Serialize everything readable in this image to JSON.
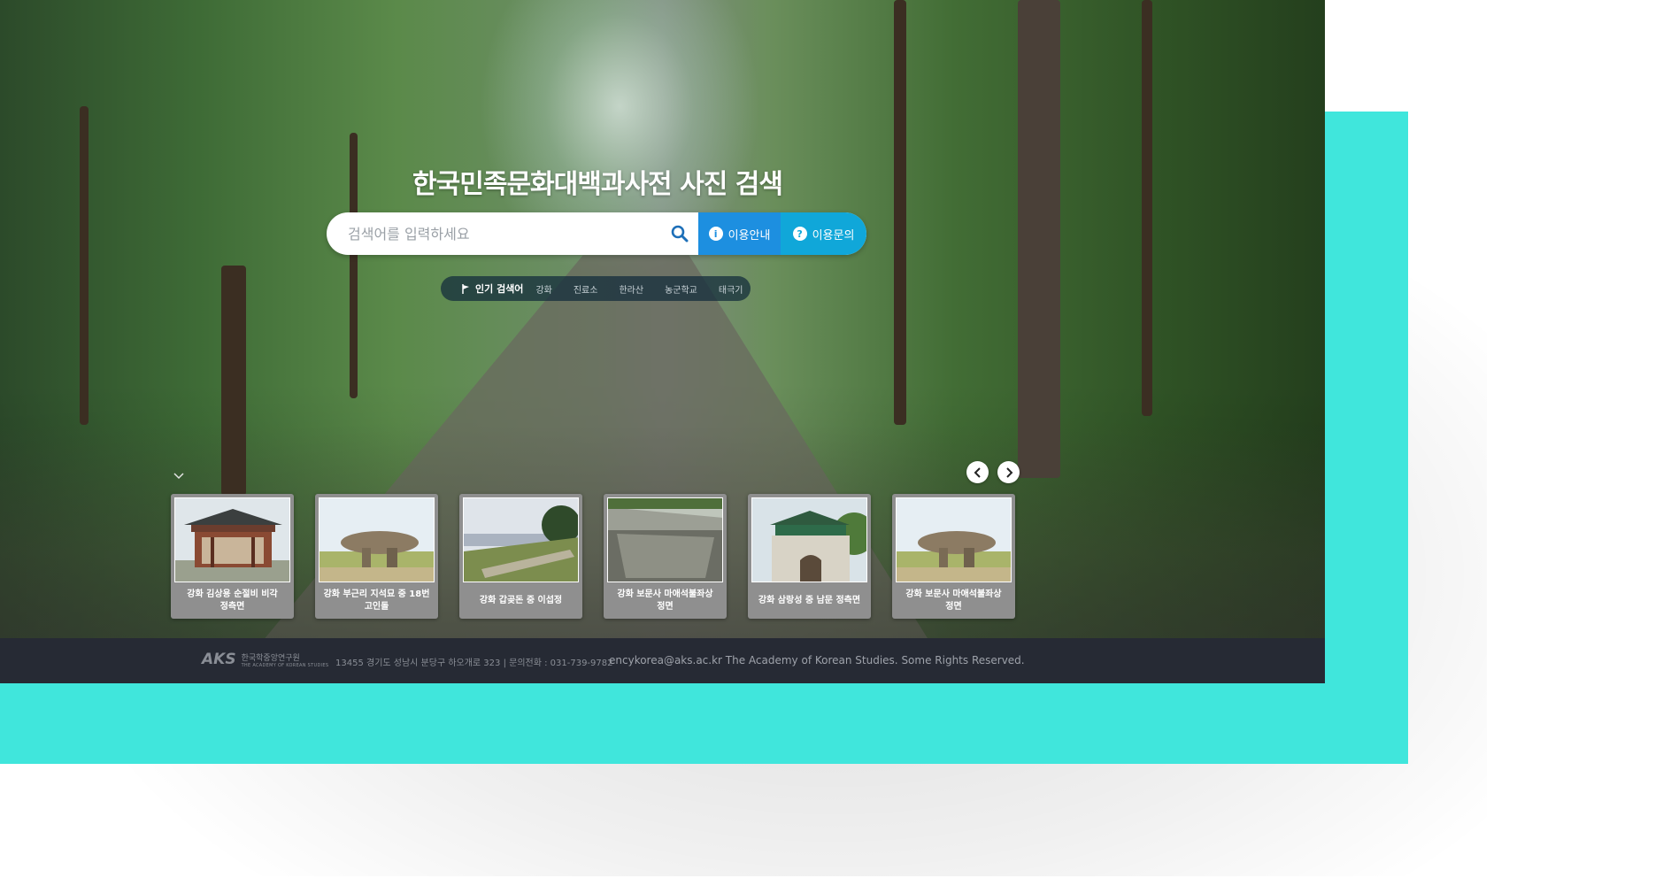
{
  "header": {
    "title": "한국민족문화대백과사전 사진 검색"
  },
  "search": {
    "placeholder": "검색어를 입력하세요",
    "guide_label": "이용안내",
    "inquiry_label": "이용문의"
  },
  "popular": {
    "label": "인기 검색어",
    "keywords": [
      "강화",
      "진료소",
      "한라산",
      "농군학교",
      "태극기"
    ]
  },
  "photos": [
    {
      "caption": "강화 김상용 순절비 비각\n정측면",
      "scene": "pavilion"
    },
    {
      "caption": "강화 부근리 지석묘 중 18번\n고인돌",
      "scene": "dolmen"
    },
    {
      "caption": "강화 갑곶돈 중 이섭정",
      "scene": "fortress"
    },
    {
      "caption": "강화 보문사 마애석불좌상\n정면",
      "scene": "rock"
    },
    {
      "caption": "강화 삼랑성 중 남문 정측면",
      "scene": "gate"
    },
    {
      "caption": "강화 보문사 마애석불좌상\n정면",
      "scene": "dolmen"
    }
  ],
  "footer": {
    "logo_ko": "한국학중앙연구원",
    "logo_en": "THE ACADEMY OF KOREAN STUDIES",
    "address": "13455 경기도 성남시 분당구 하오개로 323 | 문의전화 : 031-739-9782",
    "copyright": "encykorea@aks.ac.kr The Academy of Korean Studies. Some Rights Reserved."
  },
  "colors": {
    "backdrop": "#40e6dc",
    "guide_button": "#1d8fe0",
    "inquiry_button": "#10a7d9",
    "footer": "#262a34"
  },
  "icons": {
    "search": "search-icon",
    "guide": "info-icon",
    "inquiry": "question-icon",
    "popular": "flag-icon",
    "prev": "chevron-left-icon",
    "next": "chevron-right-icon",
    "scroll": "chevron-down-icon"
  }
}
